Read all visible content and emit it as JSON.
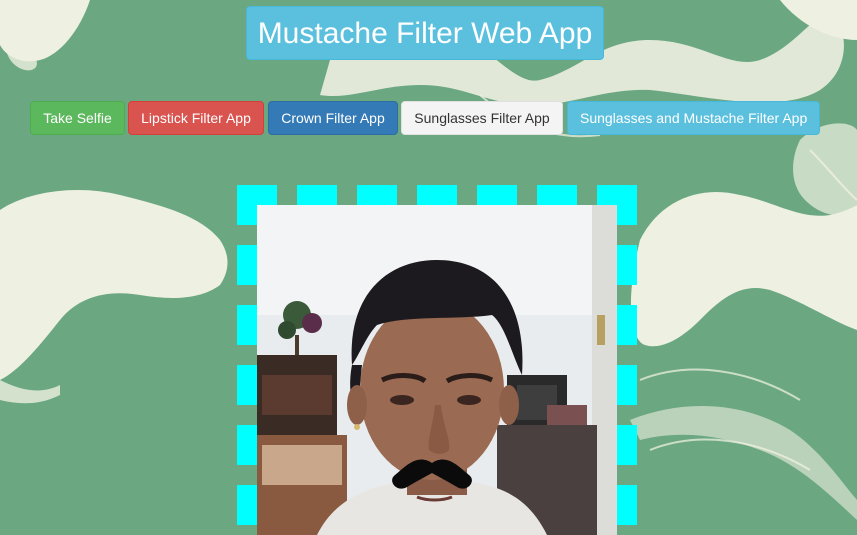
{
  "app": {
    "title": "Mustache Filter Web App"
  },
  "toolbar": {
    "buttons": [
      {
        "label": "Take Selfie",
        "style": "success",
        "color": "#5cb85c"
      },
      {
        "label": "Lipstick Filter App",
        "style": "danger",
        "color": "#d9534f"
      },
      {
        "label": "Crown Filter App",
        "style": "primary",
        "color": "#337ab7"
      },
      {
        "label": "Sunglasses Filter App",
        "style": "default",
        "color": "#f4f4f4"
      },
      {
        "label": "Sunglasses and Mustache Filter App",
        "style": "info",
        "color": "#5bc0de"
      }
    ]
  },
  "camera": {
    "frame_color": "#00ffff",
    "overlay": "mustache",
    "background_color": "#6ba882"
  }
}
